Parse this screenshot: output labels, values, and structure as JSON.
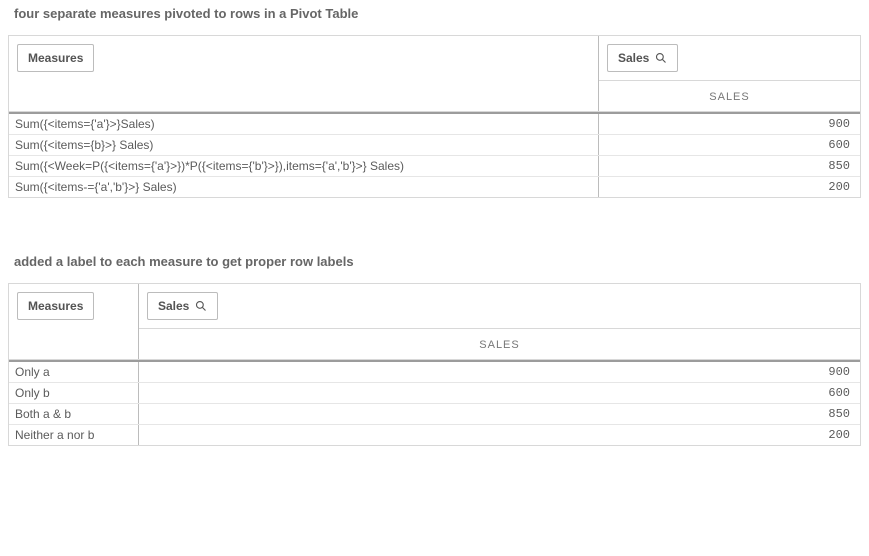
{
  "table1": {
    "title": "four separate measures pivoted to rows in a Pivot Table",
    "measures_chip": "Measures",
    "sales_chip": "Sales",
    "column_header": "SALES",
    "rows": [
      {
        "label": "Sum({<items={'a'}>}Sales)",
        "value": "900"
      },
      {
        "label": "Sum({<items={b}>} Sales)",
        "value": "600"
      },
      {
        "label": "Sum({<Week=P({<items={'a'}>})*P({<items={'b'}>}),items={'a','b'}>} Sales)",
        "value": "850"
      },
      {
        "label": "Sum({<items-={'a','b'}>} Sales)",
        "value": "200"
      }
    ]
  },
  "table2": {
    "title": "added a label to each measure to get proper row labels",
    "measures_chip": "Measures",
    "sales_chip": "Sales",
    "column_header": "SALES",
    "rows": [
      {
        "label": "Only a",
        "value": "900"
      },
      {
        "label": "Only b",
        "value": "600"
      },
      {
        "label": "Both a & b",
        "value": "850"
      },
      {
        "label": "Neither a nor b",
        "value": "200"
      }
    ]
  }
}
